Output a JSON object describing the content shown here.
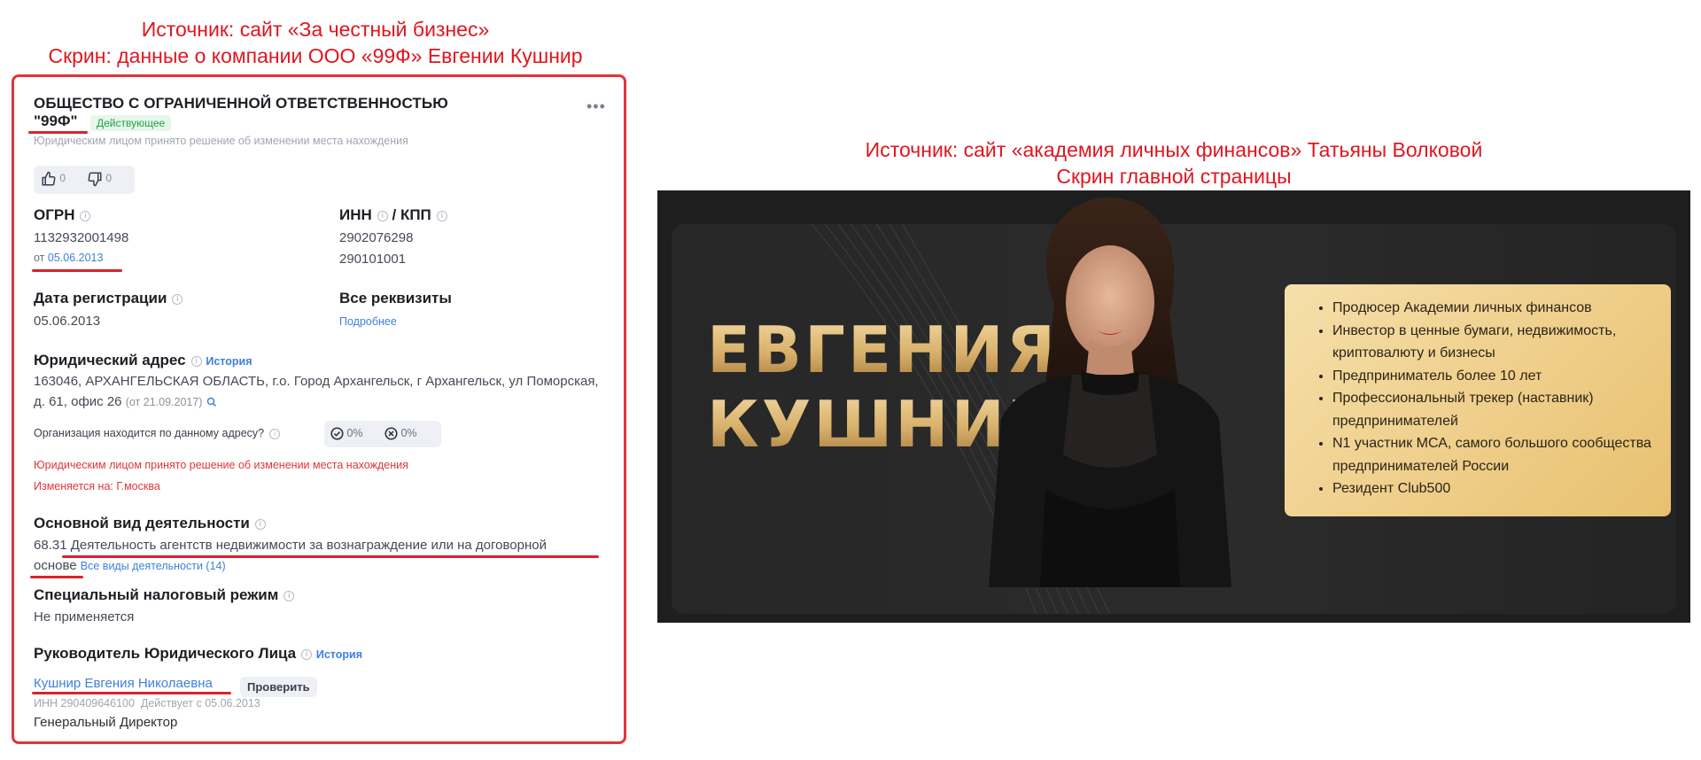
{
  "captions": {
    "left_line1": "Источник: сайт «За честный бизнес»",
    "left_line2": "Скрин: данные о компании ООО «99Ф» Евгении Кушнир",
    "right_line1": "Источник: сайт «академия личных финансов» Татьяны Волковой",
    "right_line2": "Скрин главной страницы"
  },
  "company": {
    "name_line1": "ОБЩЕСТВО С ОГРАНИЧЕННОЙ ОТВЕТСТВЕННОСТЬЮ",
    "name_line2": "\"99Ф\"",
    "status": "Действующее",
    "menu_glyph": "•••",
    "relocation_note": "Юридическим лицом принято решение об изменении места нахождения",
    "likes": "0",
    "dislikes": "0",
    "ogrn_label": "ОГРН",
    "ogrn": "1132932001498",
    "ogrn_date_prefix": "от",
    "ogrn_date": "05.06.2013",
    "inn_label": "ИНН",
    "kpp_label": "/ КПП",
    "inn": "2902076298",
    "kpp": "290101001",
    "reg_date_label": "Дата регистрации",
    "reg_date": "05.06.2013",
    "requisites_label": "Все реквизиты",
    "requisites_link": "Подробнее",
    "address_label": "Юридический адрес",
    "address_history": "История",
    "address_line1": "163046, АРХАНГЕЛЬСКАЯ ОБЛАСТЬ, г.о. Город Архангельск, г Архангельск, ул Поморская,",
    "address_line2": "д. 61, офис 26",
    "address_since": "(от 21.09.2017)",
    "location_question": "Организация находится по данному адресу?",
    "yes_percent": "0%",
    "no_percent": "0%",
    "relocation_warning": "Юридическим лицом принято решение об изменении места нахождения",
    "changes_to": "Изменяется на: Г.москва",
    "activity_label": "Основной вид деятельности",
    "activity_code": "68.31",
    "activity_text_line1": "Деятельность агентств недвижимости за вознаграждение или на договорной",
    "activity_text_line2": "основе",
    "activity_all_link": "Все виды деятельности (14)",
    "tax_label": "Специальный налоговый режим",
    "tax_value": "Не применяется",
    "head_label": "Руководитель Юридического Лица",
    "head_history": "История",
    "head_name": "Кушнир Евгения Николаевна",
    "check_button": "Проверить",
    "head_inn": "ИНН 290409646100",
    "head_since": "Действует с 05.06.2013",
    "head_position": "Генеральный Директор"
  },
  "banner": {
    "first_name": "ЕВГЕНИЯ",
    "last_name": "КУШНИР",
    "bio": [
      "Продюсер Академии личных финансов",
      "Инвестор в ценные бумаги, недвижимость, криптовалюту и бизнесы",
      "Предприниматель более 10 лет",
      "Профессиональный трекер (наставник) предпринимателей",
      "N1 участник МСА, самого большого сообщества предпринимателей России",
      "Резидент Club500"
    ]
  }
}
